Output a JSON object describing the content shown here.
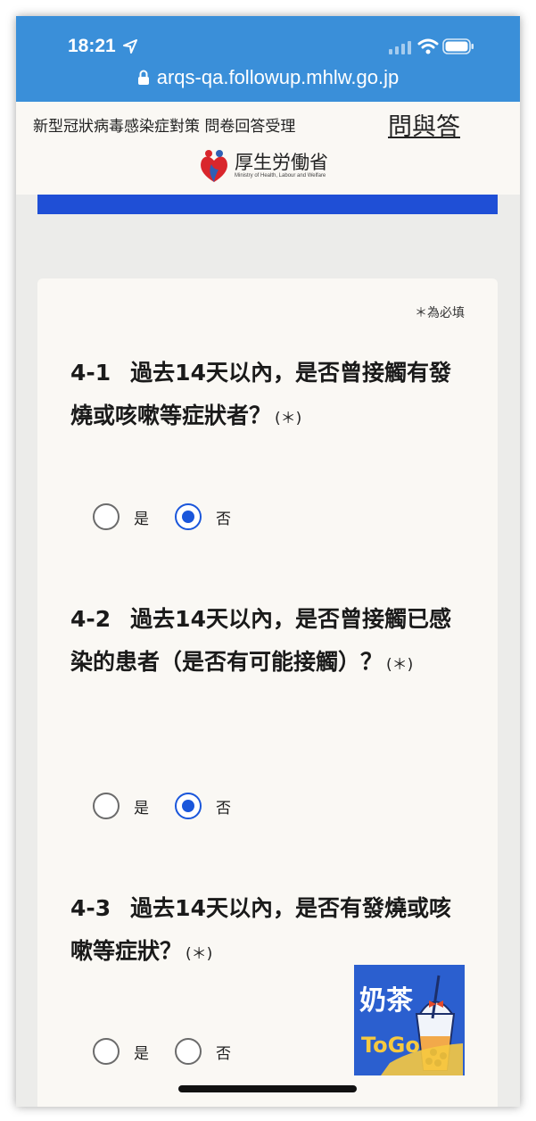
{
  "status_bar": {
    "time": "18:21",
    "url": "arqs-qa.followup.mhlw.go.jp",
    "icons": [
      "location-arrow-icon",
      "cellular-signal-icon",
      "wifi-icon",
      "battery-icon",
      "lock-icon"
    ],
    "background_color": "#3a8fd9"
  },
  "header": {
    "title": "新型冠狀病毒感染症對策 問卷回答受理",
    "link": "問與答",
    "logo_text": "厚生労働省",
    "logo_subtext": "Ministry of Health, Labour and Welfare"
  },
  "form": {
    "required_note": "＊為必填",
    "required_mark": "(＊)",
    "questions": [
      {
        "number": "4-1",
        "text": "過去14天以內，是否曾接觸有發燒或咳嗽等症狀者？",
        "options": [
          {
            "label": "是",
            "checked": false
          },
          {
            "label": "否",
            "checked": true
          }
        ]
      },
      {
        "number": "4-2",
        "text": "過去14天以內，是否曾接觸已感染的患者（是否有可能接觸）？",
        "options": [
          {
            "label": "是",
            "checked": false
          },
          {
            "label": "否",
            "checked": true
          }
        ]
      },
      {
        "number": "4-3",
        "text": "過去14天以內，是否有發燒或咳嗽等症狀？",
        "options": [
          {
            "label": "是",
            "checked": false
          },
          {
            "label": "否",
            "checked": false
          }
        ]
      }
    ]
  },
  "sticker": {
    "text_top": "奶茶",
    "text_bottom": "ToGo"
  },
  "colors": {
    "accent_blue": "#1f4fd6",
    "radio_selected": "#1a56db",
    "card_background": "#faf8f4"
  }
}
